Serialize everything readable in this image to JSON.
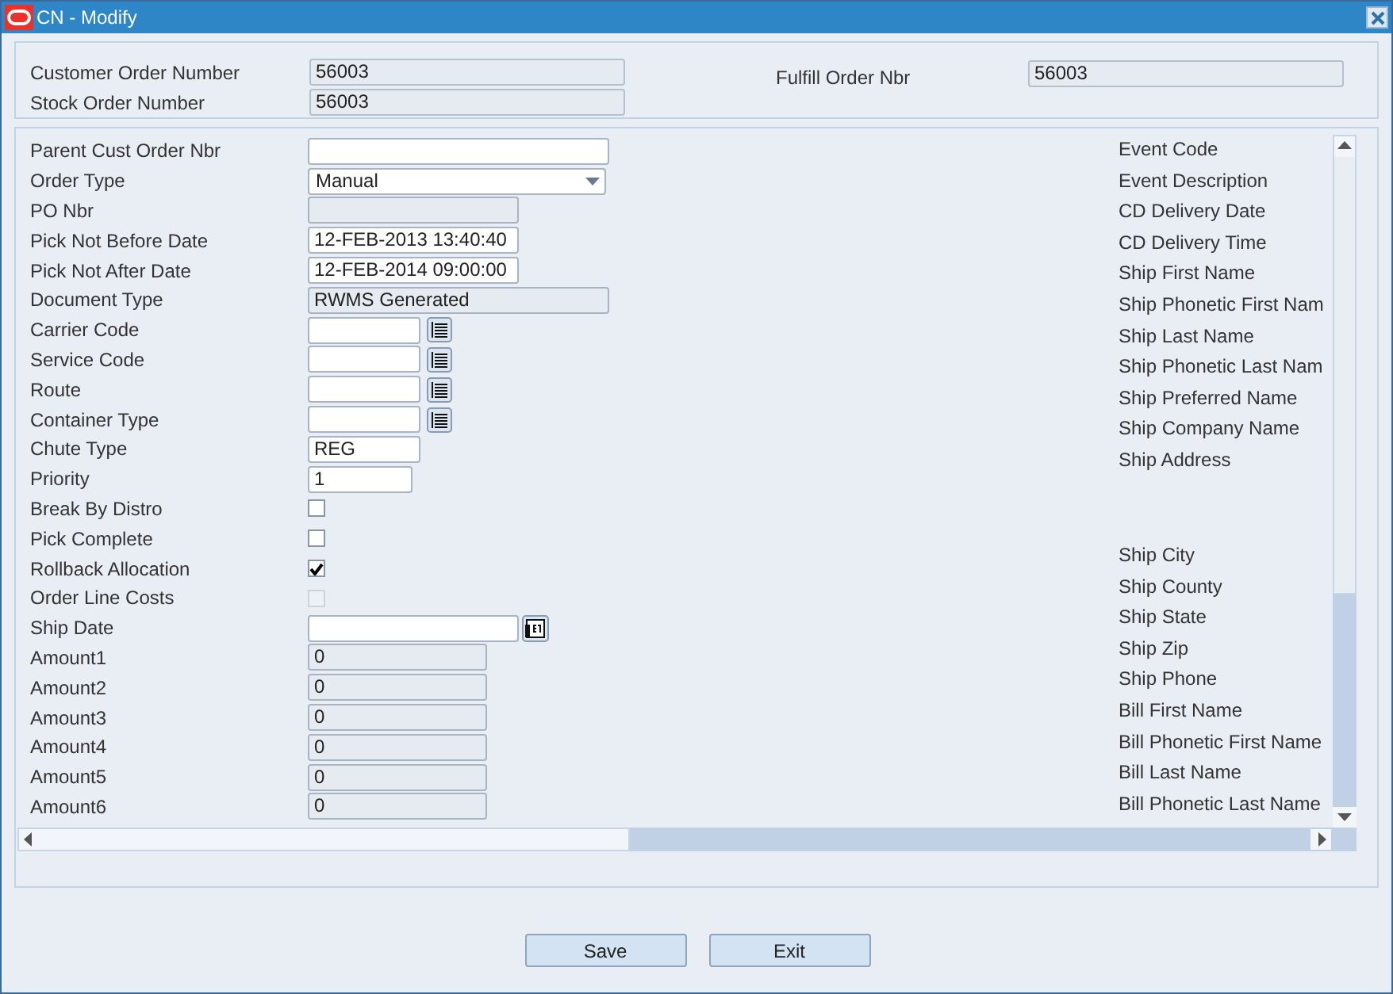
{
  "window": {
    "title": "CN - Modify"
  },
  "header": {
    "left": [
      {
        "label": "Customer Order Number",
        "value": "56003"
      },
      {
        "label": "Stock Order Number",
        "value": "56003"
      }
    ],
    "right": {
      "label": "Fulfill Order Nbr",
      "value": "56003"
    }
  },
  "form": [
    {
      "label": "Parent Cust Order Nbr",
      "kind": "text",
      "disabled": false
    },
    {
      "label": "Order Type",
      "kind": "select",
      "value": "Manual",
      "disabled": false
    },
    {
      "label": "PO Nbr",
      "kind": "text",
      "disabled": true
    },
    {
      "label": "Pick Not Before Date",
      "kind": "text",
      "value": "12-FEB-2013 13:40:40",
      "disabled": false
    },
    {
      "label": "Pick Not After Date",
      "kind": "text",
      "value": "12-FEB-2014 09:00:00",
      "disabled": false
    },
    {
      "label": "Document Type",
      "kind": "text",
      "value": "RWMS Generated",
      "disabled": true
    },
    {
      "label": "Carrier Code",
      "kind": "lookup",
      "disabled": false
    },
    {
      "label": "Service Code",
      "kind": "lookup",
      "disabled": false
    },
    {
      "label": "Route",
      "kind": "lookup",
      "disabled": false
    },
    {
      "label": "Container Type",
      "kind": "lookup",
      "disabled": false
    },
    {
      "label": "Chute Type",
      "kind": "text",
      "value": "REG",
      "disabled": false
    },
    {
      "label": "Priority",
      "kind": "text",
      "value": "1",
      "disabled": false
    },
    {
      "label": "Break By Distro",
      "kind": "check",
      "checked": false,
      "disabled": false
    },
    {
      "label": "Pick Complete",
      "kind": "check",
      "checked": false,
      "disabled": false
    },
    {
      "label": "Rollback Allocation",
      "kind": "check",
      "checked": true,
      "disabled": false
    },
    {
      "label": "Order Line Costs",
      "kind": "check",
      "checked": false,
      "disabled": true
    },
    {
      "label": "Ship Date",
      "kind": "date",
      "disabled": false
    },
    {
      "label": "Amount1",
      "kind": "text",
      "value": "0",
      "disabled": true
    },
    {
      "label": "Amount2",
      "kind": "text",
      "value": "0",
      "disabled": true
    },
    {
      "label": "Amount3",
      "kind": "text",
      "value": "0",
      "disabled": true
    },
    {
      "label": "Amount4",
      "kind": "text",
      "value": "0",
      "disabled": true
    },
    {
      "label": "Amount5",
      "kind": "text",
      "value": "0",
      "disabled": true
    },
    {
      "label": "Amount6",
      "kind": "text",
      "value": "0",
      "disabled": true
    }
  ],
  "side_labels": [
    {
      "label": "Event Code",
      "kind": "single"
    },
    {
      "label": "Event Description",
      "kind": "single"
    },
    {
      "label": "CD Delivery Date",
      "kind": "single"
    },
    {
      "label": "CD Delivery Time",
      "kind": "single"
    },
    {
      "label": "Ship First Name",
      "kind": "single"
    },
    {
      "label": "Ship Phonetic First Nam",
      "kind": "single"
    },
    {
      "label": "Ship Last Name",
      "kind": "single"
    },
    {
      "label": "Ship Phonetic Last Nam",
      "kind": "single"
    },
    {
      "label": "Ship Preferred Name",
      "kind": "single"
    },
    {
      "label": "Ship Company Name",
      "kind": "single"
    },
    {
      "label": "Ship Address",
      "kind": "multiline"
    },
    {
      "label": "Ship City",
      "kind": "single"
    },
    {
      "label": "Ship County",
      "kind": "single"
    },
    {
      "label": "Ship State",
      "kind": "single"
    },
    {
      "label": "Ship Zip",
      "kind": "single"
    },
    {
      "label": "Ship Phone",
      "kind": "single"
    },
    {
      "label": "Bill First Name",
      "kind": "single"
    },
    {
      "label": "Bill Phonetic First Name",
      "kind": "single"
    },
    {
      "label": "Bill Last Name",
      "kind": "single"
    },
    {
      "label": "Bill Phonetic Last Name",
      "kind": "single"
    }
  ],
  "buttons": [
    "Save",
    "Exit"
  ]
}
